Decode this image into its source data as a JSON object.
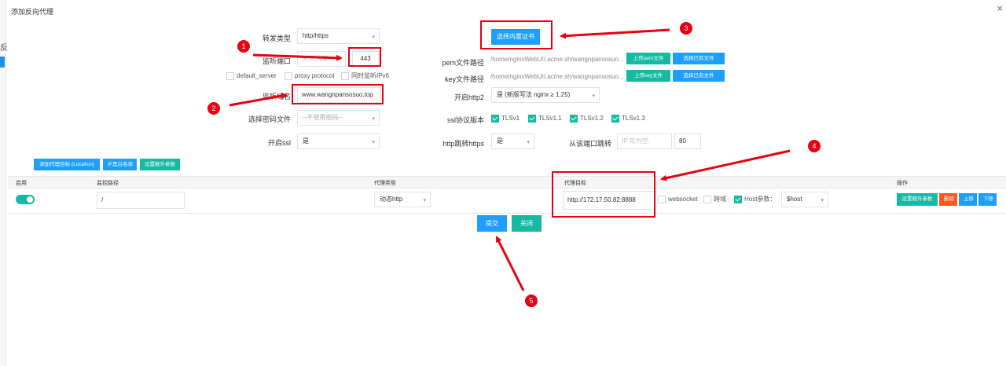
{
  "window": {
    "title": "添加反向代理",
    "close_icon": "×"
  },
  "left_strip": {
    "char": "反"
  },
  "form_left": {
    "forward_type_label": "转发类型",
    "forward_type_value": "http/https",
    "listen_port_label": "监听端口",
    "listen_port_placeholder": "IP 可为空",
    "listen_port_value": "443",
    "default_server_label": "default_server",
    "proxy_protocol_label": "proxy protocol",
    "ipv6_label": "同时监听IPv6",
    "domain_label": "监听域名",
    "domain_value": "www.wangnpansosuo.top",
    "password_file_label": "选择密码文件",
    "password_file_value": "--不使用密码--",
    "ssl_label": "开启ssl",
    "ssl_value": "是"
  },
  "form_right": {
    "cert_button": "选择内置证书",
    "pem_label": "pem文件路径",
    "pem_path": "/home/nginxWebUI/.acme.sh/wangnpansosuo...",
    "upload_pem": "上传pem文件",
    "choose_pem": "选择已有文件",
    "key_label": "key文件路径",
    "key_path": "/home/nginxWebUI/.acme.sh/wangnpansosuo...",
    "upload_key": "上传key文件",
    "choose_key": "选择已有文件",
    "http2_label": "开启http2",
    "http2_value": "是 (新版写法 nginx ≥ 1.25)",
    "ssl_protocol_label": "ssl协议版本",
    "tls": [
      "TLSv1",
      "TLSv1.1",
      "TLSv1.2",
      "TLSv1.3"
    ],
    "http_redirect_label": "http跳转https",
    "http_redirect_value": "是",
    "redirect_port_label": "从该端口跳转",
    "redirect_ip_placeholder": "IP 可为空:",
    "redirect_port_value": "80"
  },
  "toolbar": {
    "add_target": "添加代理目标 (Location)",
    "ip_blacklist": "IP黑白名单",
    "extra_params": "设置额外参数"
  },
  "table": {
    "headers": {
      "enable": "启用",
      "path": "监控路径",
      "proxy_type": "代理类型",
      "proxy_target": "代理目标",
      "actions": "操作"
    },
    "row": {
      "path": "/",
      "proxy_type": "动态http",
      "target": "http://172.17.50.82:8888",
      "websocket": "websocket",
      "cross_domain": "跨域",
      "host_param_label": "Host参数：",
      "host_param_value": "$host",
      "btn_extra": "设置额外参数",
      "btn_delete": "删除",
      "btn_up": "上移",
      "btn_down": "下移"
    }
  },
  "footer": {
    "submit": "提交",
    "close": "关闭"
  },
  "markers": [
    "1",
    "2",
    "3",
    "4",
    "5"
  ],
  "colors": {
    "teal": "#16b9a2",
    "blue": "#1e9fff",
    "orange": "#ff5722",
    "annotation_red": "#e60012"
  }
}
